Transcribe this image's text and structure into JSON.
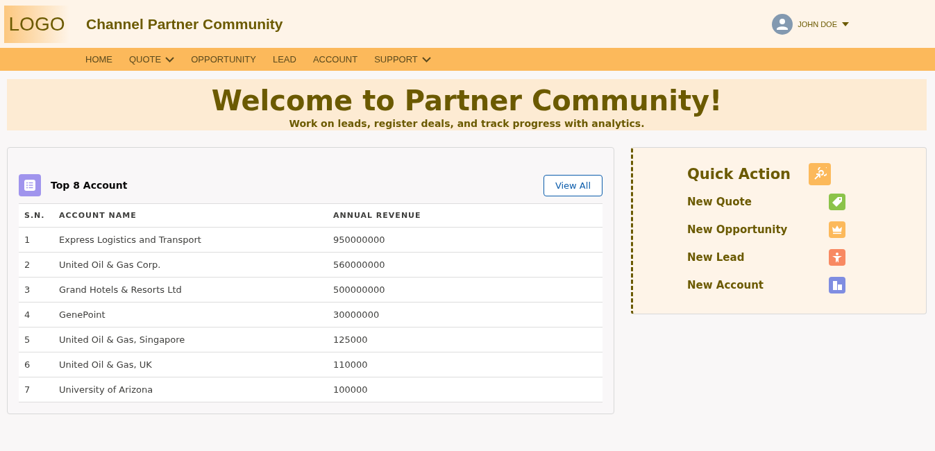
{
  "header": {
    "logo": "LOGO",
    "title": "Channel Partner Community",
    "user": "JOHN DOE"
  },
  "nav": [
    {
      "label": "HOME",
      "dropdown": false
    },
    {
      "label": "QUOTE",
      "dropdown": true
    },
    {
      "label": "OPPORTUNITY",
      "dropdown": false
    },
    {
      "label": "LEAD",
      "dropdown": false
    },
    {
      "label": "ACCOUNT",
      "dropdown": false
    },
    {
      "label": "SUPPORT",
      "dropdown": true
    }
  ],
  "banner": {
    "title": "Welcome to Partner Community!",
    "subtitle": "Work on leads, register deals, and track progress with analytics."
  },
  "accounts": {
    "title": "Top 8 Account",
    "button": "View All",
    "columns": [
      "S.N.",
      "ACCOUNT NAME",
      "ANNUAL REVENUE"
    ],
    "rows": [
      [
        "1",
        "Express Logistics and Transport",
        "950000000"
      ],
      [
        "2",
        "United Oil & Gas Corp.",
        "560000000"
      ],
      [
        "3",
        "Grand Hotels & Resorts Ltd",
        "500000000"
      ],
      [
        "4",
        "GenePoint",
        "30000000"
      ],
      [
        "5",
        "United Oil & Gas, Singapore",
        "125000"
      ],
      [
        "6",
        "United Oil & Gas, UK",
        "110000"
      ],
      [
        "7",
        "University of Arizona",
        "100000"
      ]
    ]
  },
  "quick_action": {
    "title": "Quick Action",
    "items": [
      {
        "label": "New Quote",
        "kind": "tag",
        "color": "#8bc34a"
      },
      {
        "label": "New Opportunity",
        "kind": "crown",
        "color": "#fcb95b"
      },
      {
        "label": "New Lead",
        "kind": "person",
        "color": "#f88962"
      },
      {
        "label": "New Account",
        "kind": "building",
        "color": "#7f8de1"
      }
    ]
  }
}
